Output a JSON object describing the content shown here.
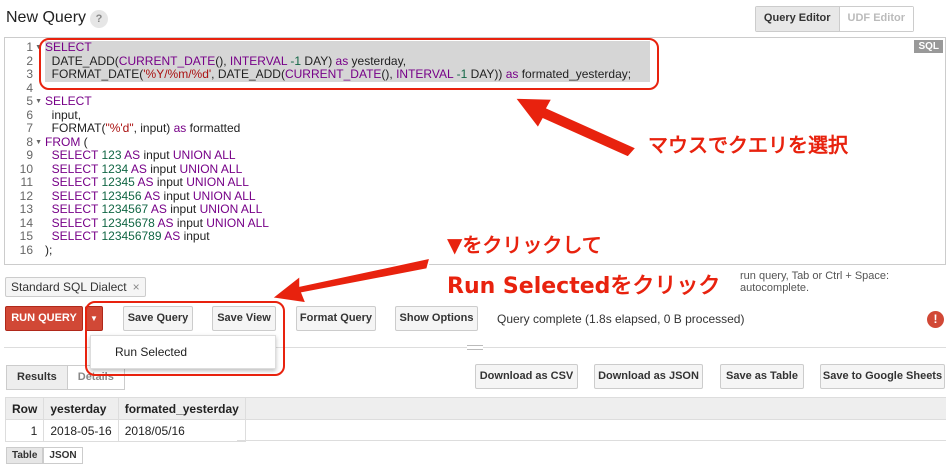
{
  "header": {
    "title": "New Query",
    "help_label": "?"
  },
  "editor_tabs": {
    "query_editor": "Query Editor",
    "udf_editor": "UDF Editor"
  },
  "editor": {
    "badge": "SQL",
    "line_numbers": [
      "1",
      "2",
      "3",
      "4",
      "5",
      "6",
      "7",
      "8",
      "9",
      "10",
      "11",
      "12",
      "13",
      "14",
      "15",
      "16"
    ],
    "fold_markers": [
      1,
      5,
      8
    ]
  },
  "dialect_chip": {
    "label": "Standard SQL Dialect",
    "close": "×"
  },
  "hint_text": "run query, Tab or Ctrl + Space: autocomplete.",
  "toolbar": {
    "run": "RUN QUERY",
    "save_query": "Save Query",
    "save_view": "Save View",
    "format_query": "Format Query",
    "show_options": "Show Options",
    "status": "Query complete (1.8s elapsed, 0 B processed)",
    "error_icon": "!"
  },
  "dropdown": {
    "run_selected": "Run Selected"
  },
  "result_tabs": {
    "results": "Results",
    "details": "Details"
  },
  "result_actions": {
    "download_csv": "Download as CSV",
    "download_json": "Download as JSON",
    "save_table": "Save as Table",
    "save_sheets": "Save to Google Sheets"
  },
  "results": {
    "headers": [
      "Row",
      "yesterday",
      "formated_yesterday"
    ],
    "rows": [
      [
        "1",
        "2018-05-16",
        "2018/05/16"
      ]
    ]
  },
  "format_tabs": {
    "table": "Table",
    "json": "JSON"
  },
  "annotations": {
    "select_query": "マウスでクエリを選択",
    "click_arrow_line1": "▼をクリックして",
    "click_arrow_line2": "Run Selectedをクリック",
    "color": "#e8220e"
  },
  "colors": {
    "keyword": "#770088",
    "string": "#aa1111",
    "number": "#116644",
    "run_button": "#d14836",
    "selection": "#d6d6d6"
  }
}
